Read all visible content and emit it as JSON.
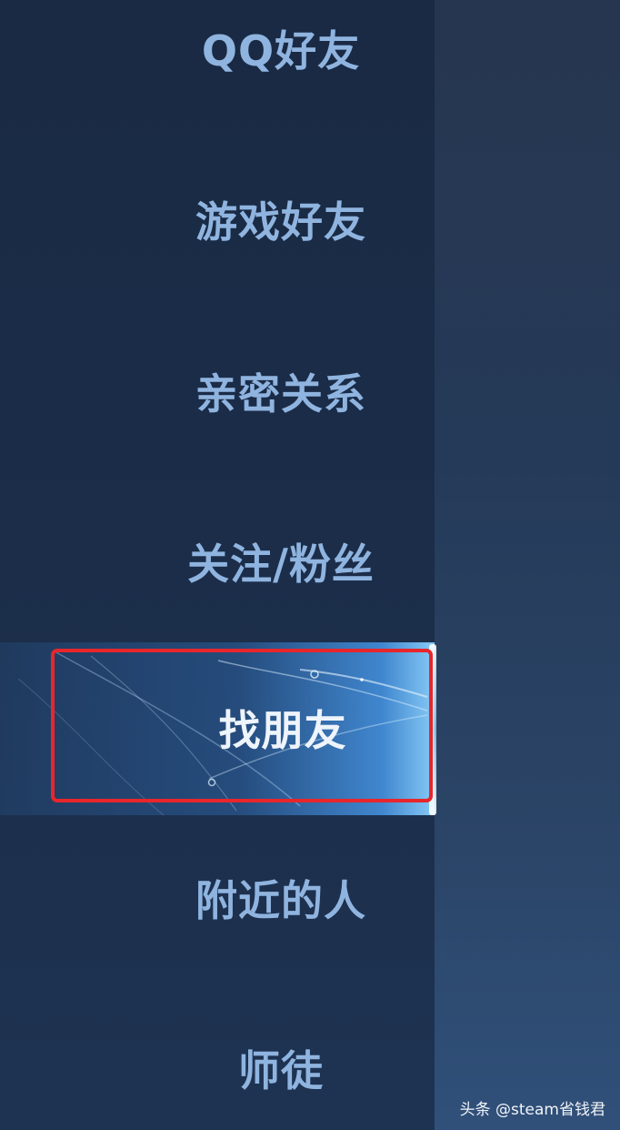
{
  "menu": {
    "items": [
      {
        "label": "QQ好友",
        "active": false
      },
      {
        "label": "游戏好友",
        "active": false
      },
      {
        "label": "亲密关系",
        "active": false
      },
      {
        "label": "关注/粉丝",
        "active": false
      },
      {
        "label": "找朋友",
        "active": true
      },
      {
        "label": "附近的人",
        "active": false
      },
      {
        "label": "师徒",
        "active": false
      }
    ]
  },
  "watermark": "头条 @steam省钱君",
  "colors": {
    "label": "#8fb4df",
    "active_label": "#eef4fb",
    "highlight_border": "#e8262b",
    "sidebar_bg": "#1b2d49"
  }
}
